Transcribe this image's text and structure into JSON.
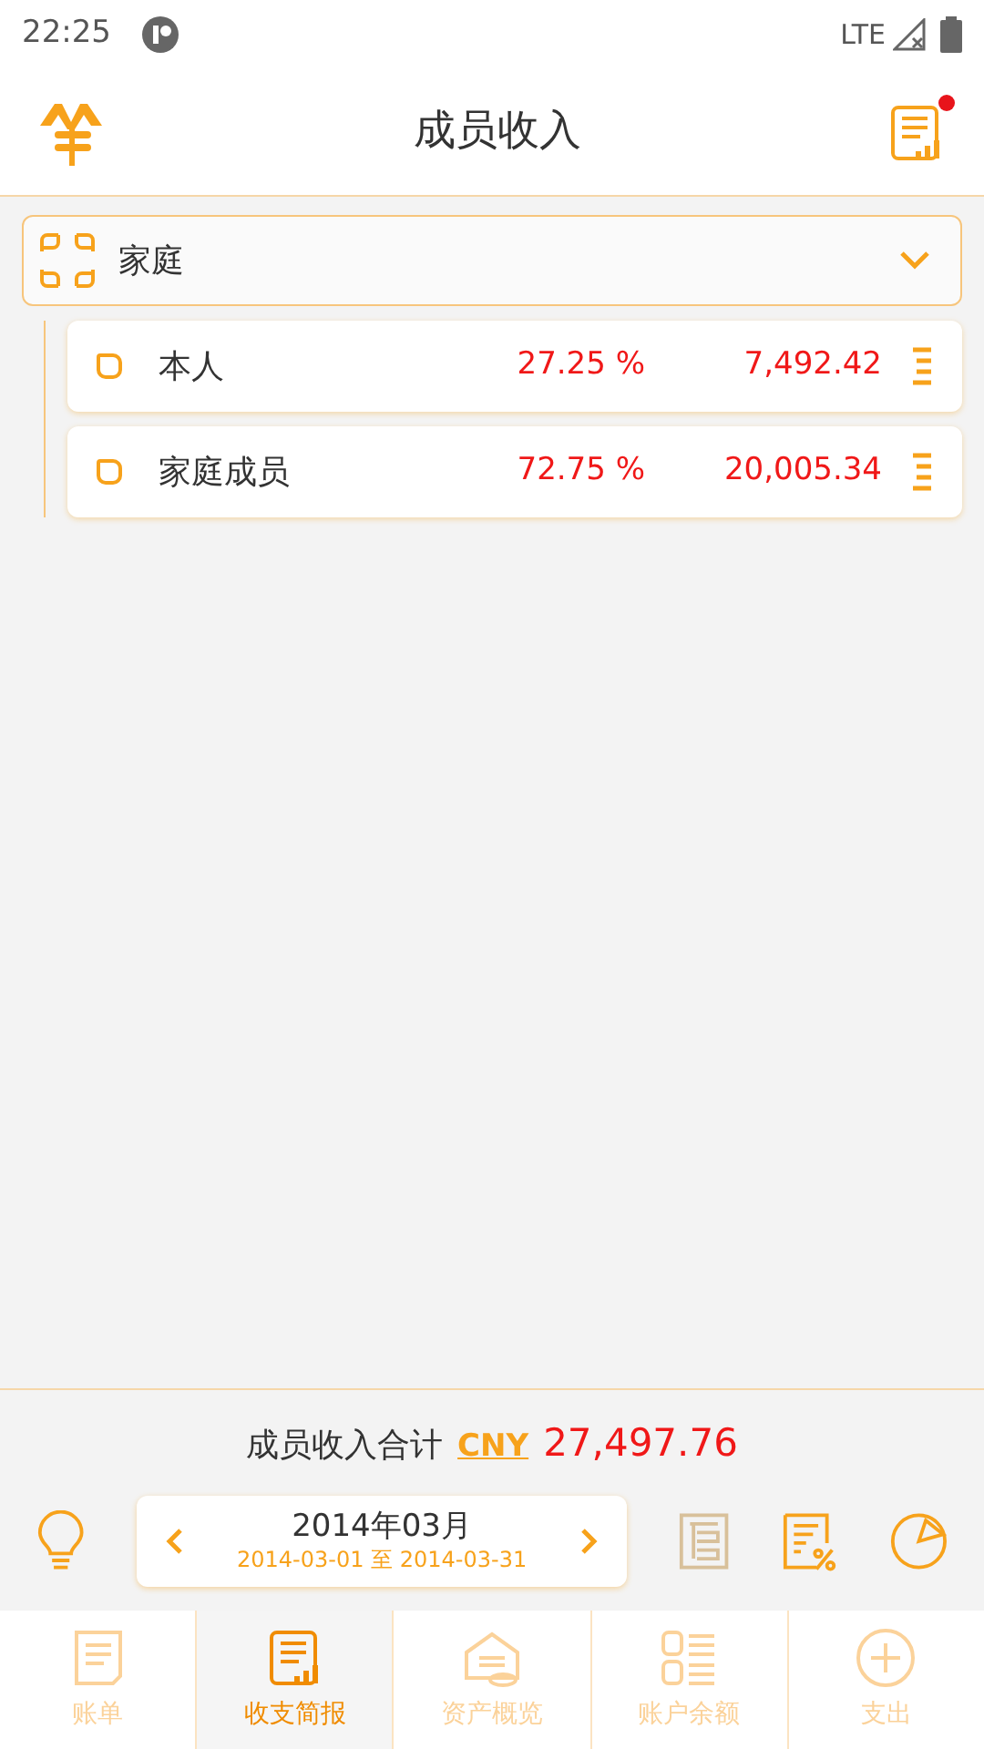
{
  "status_bar": {
    "time": "22:25",
    "network": "LTE"
  },
  "header": {
    "title": "成员收入",
    "report_has_notification": true
  },
  "group": {
    "name": "家庭",
    "expanded": true,
    "children": [
      {
        "name": "本人",
        "percent": "27.25 %",
        "amount": "7,492.42"
      },
      {
        "name": "家庭成员",
        "percent": "72.75 %",
        "amount": "20,005.34"
      }
    ]
  },
  "summary": {
    "label": "成员收入合计",
    "currency": "CNY",
    "total": "27,497.76"
  },
  "period": {
    "month": "2014年03月",
    "from": "2014-03-01",
    "separator": "至",
    "to": "2014-03-31"
  },
  "tabs": [
    {
      "label": "账单",
      "selected": false
    },
    {
      "label": "收支简报",
      "selected": true
    },
    {
      "label": "资产概览",
      "selected": false
    },
    {
      "label": "账户余额",
      "selected": false
    },
    {
      "label": "支出",
      "selected": false
    }
  ]
}
